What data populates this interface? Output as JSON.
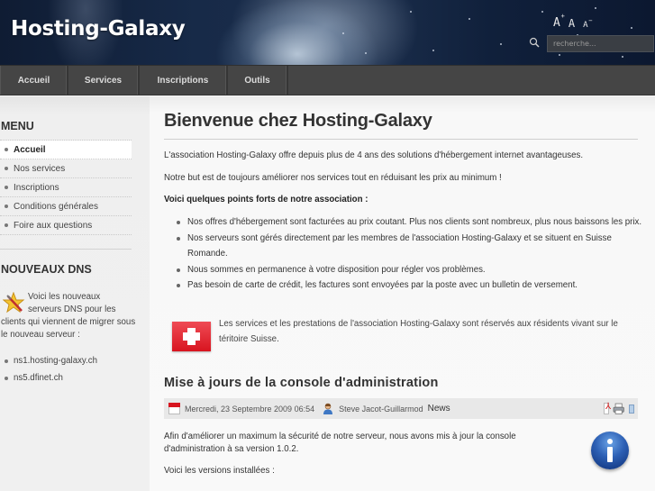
{
  "header": {
    "logo": "Hosting-Galaxy",
    "font_tools": {
      "increase": "A",
      "increase_mark": "+",
      "normal": "A",
      "decrease": "A",
      "decrease_mark": "−"
    },
    "search": {
      "placeholder": "recherche...",
      "value": ""
    }
  },
  "nav": {
    "items": [
      {
        "label": "Accueil"
      },
      {
        "label": "Services"
      },
      {
        "label": "Inscriptions"
      },
      {
        "label": "Outils"
      }
    ]
  },
  "sidebar": {
    "menu_title": "MENU",
    "menu": [
      {
        "label": "Accueil",
        "active": true
      },
      {
        "label": "Nos services"
      },
      {
        "label": "Inscriptions"
      },
      {
        "label": "Conditions générales"
      },
      {
        "label": "Foire aux questions"
      }
    ],
    "dns_title": "NOUVEAUX DNS",
    "dns_text": "Voici les nouveaux serveurs DNS pour les clients qui viennent de migrer sous le nouveau serveur :",
    "dns_servers": [
      "ns1.hosting-galaxy.ch",
      "ns5.dfinet.ch"
    ]
  },
  "main": {
    "title": "Bienvenue chez Hosting-Galaxy",
    "intro": "L'association Hosting-Galaxy offre depuis plus de 4 ans des solutions d'hébergement internet avantageuses.",
    "goal": "Notre but est de toujours améliorer nos services tout en réduisant les prix au minimum !",
    "strengths_title": "Voici quelques points forts de notre association :",
    "strengths": [
      "Nos offres d'hébergement sont facturées au prix coutant. Plus nos clients sont nombreux, plus nous baissons les prix.",
      "Nos serveurs sont gérés directement par les membres de l'association Hosting-Galaxy et se situent en Suisse Romande.",
      "Nous sommes en permanence à votre disposition pour régler vos problèmes.",
      "Pas besoin de carte de crédit, les factures sont envoyées par la poste avec un bulletin de versement."
    ],
    "swiss_notice": "Les services et les prestations de l'association Hosting-Galaxy sont réservés aux résidents vivant sur le téritoire Suisse.",
    "article": {
      "title": "Mise à jours de la console d'administration",
      "date": "Mercredi, 23 Septembre 2009 06:54",
      "author": "Steve Jacot-Guillarmod",
      "category": "News",
      "body": "Afin d'améliorer un maximum la sécurité de notre serveur, nous avons mis à jour la console d'administration à sa version 1.0.2.",
      "body2": "Voici les versions installées :"
    }
  },
  "colors": {
    "nav_bg": "#454545",
    "flag_red": "#d8141f",
    "info_blue": "#2c5fb4"
  }
}
